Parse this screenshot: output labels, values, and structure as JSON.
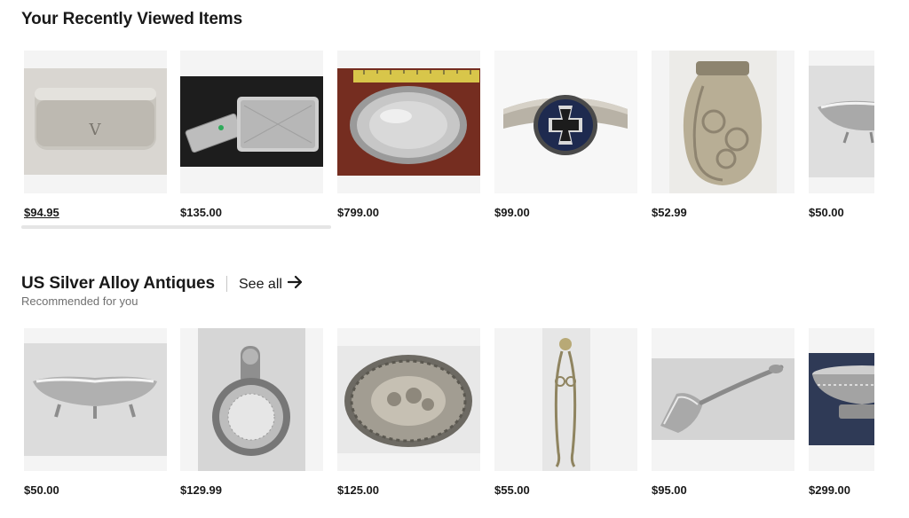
{
  "recent": {
    "title": "Your Recently Viewed Items",
    "items": [
      {
        "price": "$94.95"
      },
      {
        "price": "$135.00"
      },
      {
        "price": "$799.00"
      },
      {
        "price": "$99.00"
      },
      {
        "price": "$52.99"
      },
      {
        "price": "$50.00"
      }
    ]
  },
  "recommended": {
    "title": "US Silver Alloy Antiques",
    "see_all": "See all",
    "subtitle": "Recommended for you",
    "items": [
      {
        "price": "$50.00"
      },
      {
        "price": "$129.99"
      },
      {
        "price": "$125.00"
      },
      {
        "price": "$55.00"
      },
      {
        "price": "$95.00"
      },
      {
        "price": "$299.00"
      }
    ]
  },
  "icons": {
    "see_all_arrow": "arrow-right-icon"
  }
}
